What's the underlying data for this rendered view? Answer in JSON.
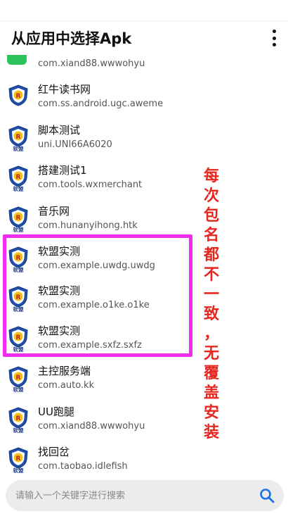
{
  "appbar": {
    "title": "从应用中选择Apk",
    "menu_icon": "more-vert-icon"
  },
  "list": {
    "partial_top_item": {
      "pkg": "com.xiand88.wwwohyu",
      "icon": "app-icon"
    },
    "items": [
      {
        "label": "红牛读书网",
        "pkg": "com.ss.android.ugc.aweme",
        "icon": "shield-r-icon",
        "icon_text": ""
      },
      {
        "label": "脚本测试",
        "pkg": "uni.UNI66A6020",
        "icon": "shield-r-icon",
        "icon_text": "软盟"
      },
      {
        "label": "搭建测试1",
        "pkg": "com.tools.wxmerchant",
        "icon": "shield-r-icon",
        "icon_text": "软盟"
      },
      {
        "label": "音乐网",
        "pkg": "com.hunanyihong.htk",
        "icon": "shield-r-icon",
        "icon_text": "软盟"
      },
      {
        "label": "软盟实测",
        "pkg": "com.example.uwdg.uwdg",
        "icon": "shield-r-icon",
        "icon_text": "软盟"
      },
      {
        "label": "软盟实测",
        "pkg": "com.example.o1ke.o1ke",
        "icon": "shield-r-icon",
        "icon_text": "软盟"
      },
      {
        "label": "软盟实测",
        "pkg": "com.example.sxfz.sxfz",
        "icon": "shield-r-icon",
        "icon_text": "软盟"
      },
      {
        "label": "主控服务端",
        "pkg": "com.auto.kk",
        "icon": "shield-r-icon",
        "icon_text": "软盟"
      },
      {
        "label": "UU跑腿",
        "pkg": "com.xiand88.wwwohyu",
        "icon": "shield-r-icon",
        "icon_text": "软盟"
      },
      {
        "label": "找回岔",
        "pkg": "com.taobao.idlefish",
        "icon": "shield-r-icon",
        "icon_text": "软盟"
      }
    ]
  },
  "annotation": {
    "chars": [
      "每",
      "次",
      "包",
      "名",
      "都",
      "不",
      "一",
      "致",
      "，",
      "无",
      "覆",
      "盖",
      "安",
      "装"
    ],
    "color": "#e8251e"
  },
  "highlight_color": "#f02df0",
  "search": {
    "placeholder": "请输入一个关键字进行搜索",
    "value": "",
    "button_icon": "search-icon",
    "accent": "#1a73e8"
  }
}
